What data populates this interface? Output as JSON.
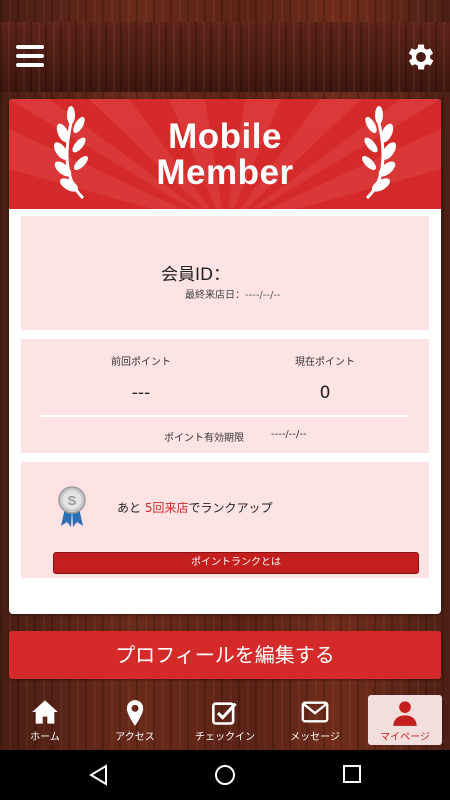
{
  "header": {
    "menu_icon": "hamburger-menu-icon",
    "settings_icon": "gear-icon"
  },
  "hero": {
    "title_line1": "Mobile",
    "title_line2": "Member",
    "background_color": "#d42a2a"
  },
  "member": {
    "id_label": "会員ID：",
    "last_visit_label": "最終来店日：",
    "last_visit_value": "----/--/--"
  },
  "points": {
    "previous_label": "前回ポイント",
    "previous_value": "---",
    "current_label": "現在ポイント",
    "current_value": "0",
    "expiry_label": "ポイント有効期限",
    "expiry_value": "----/--/--"
  },
  "rank": {
    "badge_letter": "S",
    "text_prefix": "あと",
    "text_highlight": "5回来店",
    "text_suffix": "でランクアップ",
    "button_label": "ポイントランクとは"
  },
  "edit_profile_label": "プロフィールを編集する",
  "tabs": [
    {
      "label": "ホーム",
      "icon": "home-icon"
    },
    {
      "label": "アクセス",
      "icon": "map-pin-icon"
    },
    {
      "label": "チェックイン",
      "icon": "checkbox-icon"
    },
    {
      "label": "メッセージ",
      "icon": "envelope-icon"
    },
    {
      "label": "マイページ",
      "icon": "user-icon",
      "active": true
    }
  ],
  "colors": {
    "accent": "#d42a2a",
    "panel": "#fde3e3",
    "active_tab_bg": "#f3dede"
  }
}
